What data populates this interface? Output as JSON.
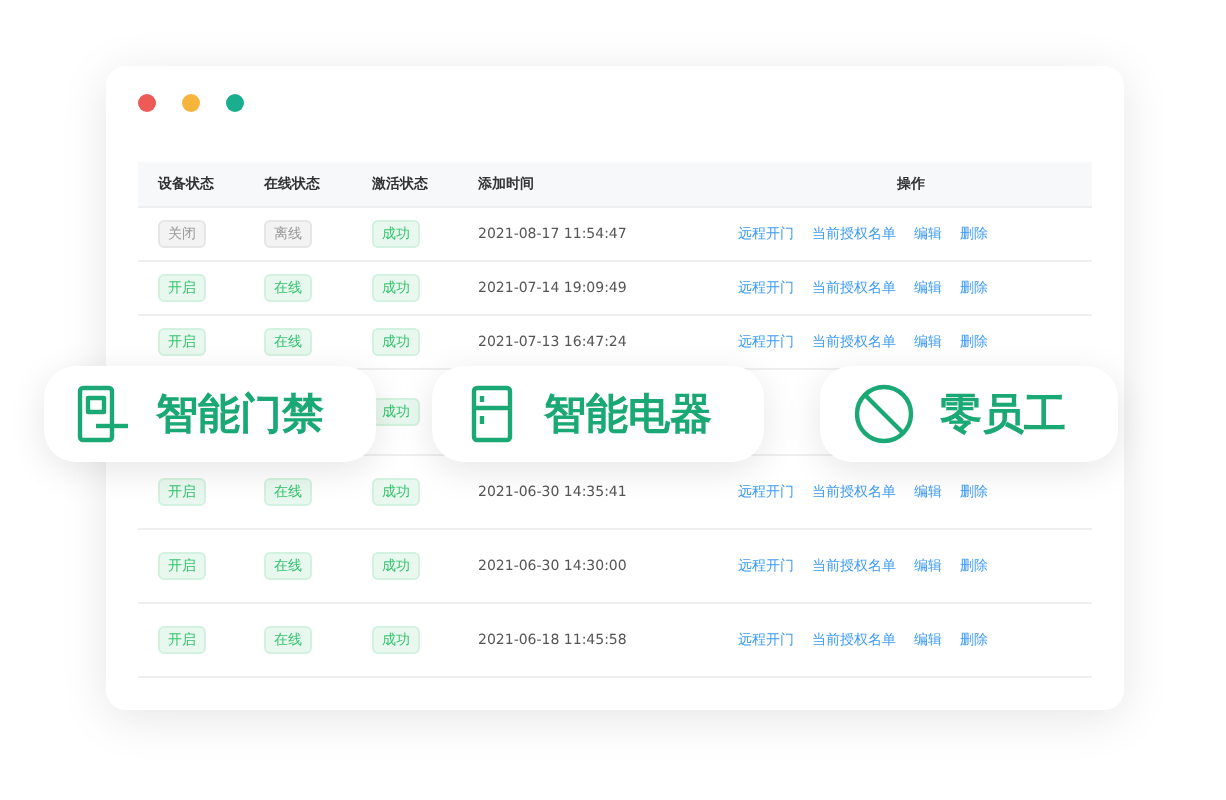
{
  "window": {
    "controls": [
      {
        "color": "#ec5b56"
      },
      {
        "color": "#f5b43c"
      },
      {
        "color": "#1aae8f"
      }
    ]
  },
  "table": {
    "columns": [
      "设备状态",
      "在线状态",
      "激活状态",
      "添加时间",
      "操作"
    ],
    "rows": [
      {
        "device": {
          "text": "关闭",
          "active": false
        },
        "online": {
          "text": "离线",
          "active": false
        },
        "activation": {
          "text": "成功",
          "active": true
        },
        "time": "2021-08-17 11:54:47",
        "actions": [
          "远程开门",
          "当前授权名单",
          "编辑",
          "删除"
        ]
      },
      {
        "device": {
          "text": "开启",
          "active": true
        },
        "online": {
          "text": "在线",
          "active": true
        },
        "activation": {
          "text": "成功",
          "active": true
        },
        "time": "2021-07-14 19:09:49",
        "actions": [
          "远程开门",
          "当前授权名单",
          "编辑",
          "删除"
        ]
      },
      {
        "device": {
          "text": "开启",
          "active": true
        },
        "online": {
          "text": "在线",
          "active": true
        },
        "activation": {
          "text": "成功",
          "active": true
        },
        "time": "2021-07-13 16:47:24",
        "actions": [
          "远程开门",
          "当前授权名单",
          "编辑",
          "删除"
        ]
      },
      {
        "activation": {
          "text": "成功",
          "active": true
        }
      },
      {
        "device": {
          "text": "开启",
          "active": true
        },
        "online": {
          "text": "在线",
          "active": true
        },
        "activation": {
          "text": "成功",
          "active": true
        },
        "time": "2021-06-30 14:35:41",
        "actions": [
          "远程开门",
          "当前授权名单",
          "编辑",
          "删除"
        ]
      },
      {
        "device": {
          "text": "开启",
          "active": true
        },
        "online": {
          "text": "在线",
          "active": true
        },
        "activation": {
          "text": "成功",
          "active": true
        },
        "time": "2021-06-30 14:30:00",
        "actions": [
          "远程开门",
          "当前授权名单",
          "编辑",
          "删除"
        ]
      },
      {
        "device": {
          "text": "开启",
          "active": true
        },
        "online": {
          "text": "在线",
          "active": true
        },
        "activation": {
          "text": "成功",
          "active": true
        },
        "time": "2021-06-18 11:45:58",
        "actions": [
          "远程开门",
          "当前授权名单",
          "编辑",
          "删除"
        ]
      }
    ]
  },
  "features": [
    {
      "kind": "access",
      "label": "智能门禁"
    },
    {
      "kind": "appliance",
      "label": "智能电器"
    },
    {
      "kind": "staffless",
      "label": "零员工"
    }
  ]
}
